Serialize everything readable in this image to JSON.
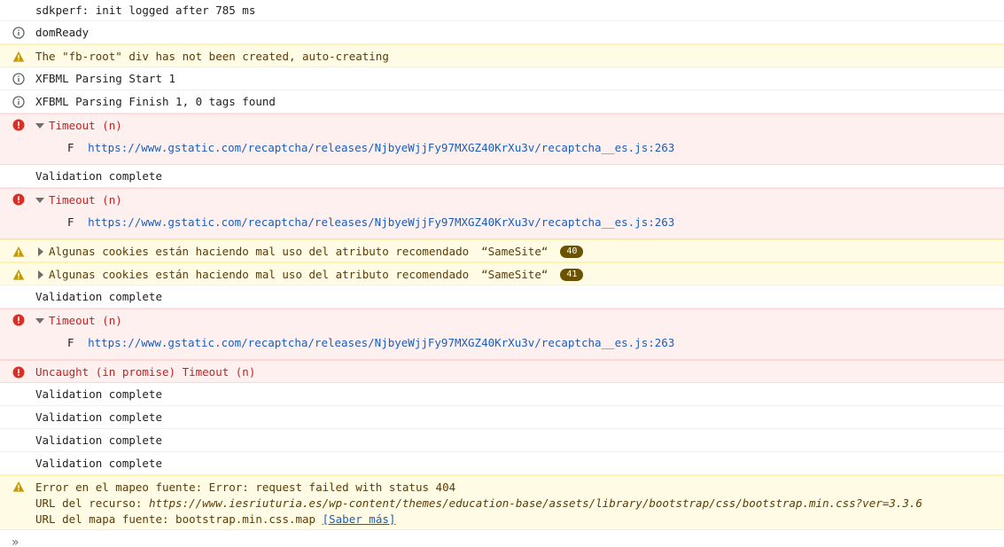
{
  "colors": {
    "info_icon": "#5f6368",
    "warn_icon": "#c49a00",
    "error_icon": "#d93025",
    "link": "#1a5ebb"
  },
  "messages": {
    "m0": {
      "text": "sdkperf: init logged after 785 ms"
    },
    "m1": {
      "icon": "info-icon",
      "text": "domReady"
    },
    "m2": {
      "icon": "warning-icon",
      "text": "The \"fb-root\" div has not been created, auto-creating"
    },
    "m3": {
      "icon": "info-icon",
      "text": "XFBML Parsing Start 1"
    },
    "m4": {
      "icon": "info-icon",
      "text": "XFBML Parsing Finish 1, 0 tags found"
    },
    "m5": {
      "icon": "error-icon",
      "text": "Timeout (n)",
      "frame_fn": "F",
      "url": "https://www.gstatic.com/recaptcha/releases/NjbyeWjjFy97MXGZ40KrXu3v/recaptcha__es.js",
      "line": ":263"
    },
    "m6": {
      "text": "Validation complete"
    },
    "m7": {
      "icon": "error-icon",
      "text": "Timeout (n)",
      "frame_fn": "F",
      "url": "https://www.gstatic.com/recaptcha/releases/NjbyeWjjFy97MXGZ40KrXu3v/recaptcha__es.js",
      "line": ":263"
    },
    "m8": {
      "icon": "warning-icon",
      "text": "Algunas cookies están haciendo mal uso del atributo recomendado",
      "quoted": "“SameSite“",
      "count": "40"
    },
    "m9": {
      "icon": "warning-icon",
      "text": "Algunas cookies están haciendo mal uso del atributo recomendado",
      "quoted": "“SameSite“",
      "count": "41"
    },
    "m10": {
      "text": "Validation complete"
    },
    "m11": {
      "icon": "error-icon",
      "text": "Timeout (n)",
      "frame_fn": "F",
      "url": "https://www.gstatic.com/recaptcha/releases/NjbyeWjjFy97MXGZ40KrXu3v/recaptcha__es.js",
      "line": ":263"
    },
    "m12": {
      "icon": "error-icon",
      "text": "Uncaught (in promise) Timeout (n)"
    },
    "m13": {
      "text": "Validation complete"
    },
    "m14": {
      "text": "Validation complete"
    },
    "m15": {
      "text": "Validation complete"
    },
    "m16": {
      "text": "Validation complete"
    },
    "m17": {
      "icon": "warning-icon",
      "line1": "Error en el mapeo fuente: Error: request failed with status 404",
      "line2_label": "URL del recurso: ",
      "line2_url": "https://www.iesriuturia.es/wp-content/themes/education-base/assets/library/bootstrap/css/bootstrap.min.css?ver=3.3.6",
      "line3_label": "URL del mapa fuente: bootstrap.min.css.map ",
      "line3_link": "[Saber más]"
    }
  },
  "prompt": {
    "icon": "chevron-prompt-icon",
    "glyph": "»"
  }
}
